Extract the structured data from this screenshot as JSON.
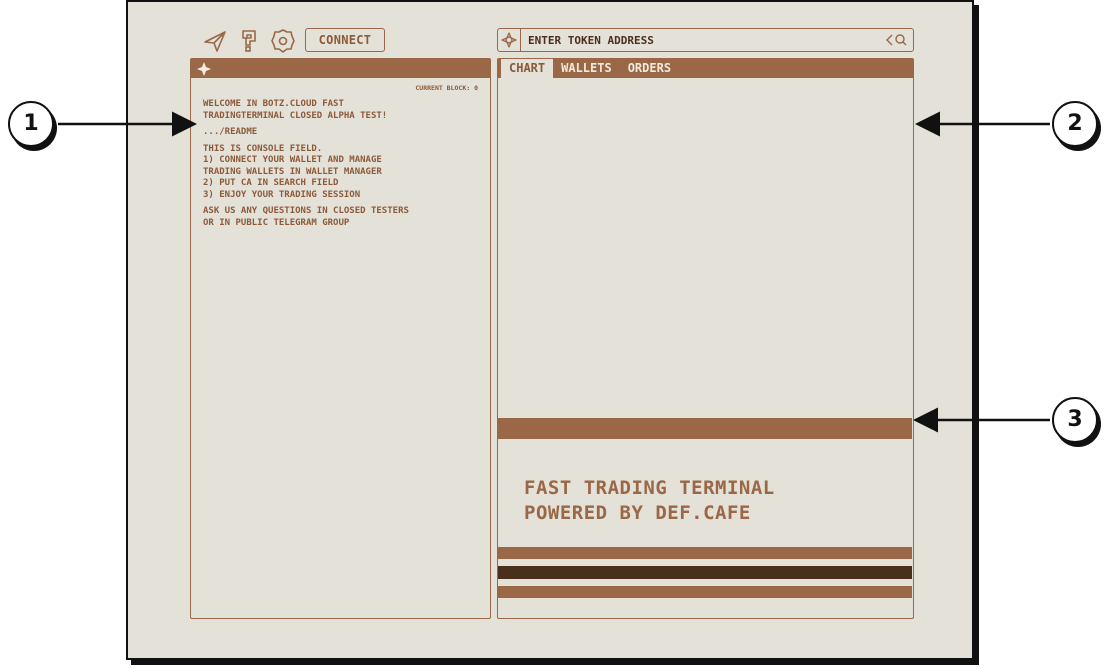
{
  "toolbar": {
    "connect_label": "CONNECT",
    "icons": [
      "send-icon",
      "help-icon",
      "settings-icon"
    ]
  },
  "search": {
    "placeholder": "ENTER TOKEN ADDRESS"
  },
  "console": {
    "current_block": "CURRENT BLOCK: 0",
    "lines": [
      "WELCOME IN BOTZ.CLOUD FAST\nTRADINGTERMINAL CLOSED ALPHA TEST!",
      ".../README",
      "THIS IS CONSOLE FIELD.\n1) CONNECT YOUR WALLET AND MANAGE\nTRADING WALLETS IN WALLET MANAGER\n2) PUT CA IN SEARCH FIELD\n3) ENJOY YOUR TRADING SESSION",
      "ASK US ANY QUESTIONS IN CLOSED TESTERS\nOR IN PUBLIC TELEGRAM GROUP"
    ]
  },
  "tabs": [
    "CHART",
    "WALLETS",
    "ORDERS"
  ],
  "tagline": {
    "line1": "FAST TRADING TERMINAL",
    "line2": "POWERED BY DEF.CAFE"
  },
  "callouts": [
    "1",
    "2",
    "3"
  ],
  "colors": {
    "accent": "#9a6846",
    "background": "#e3e1d8",
    "dark_stripe": "#4b2f1d"
  }
}
